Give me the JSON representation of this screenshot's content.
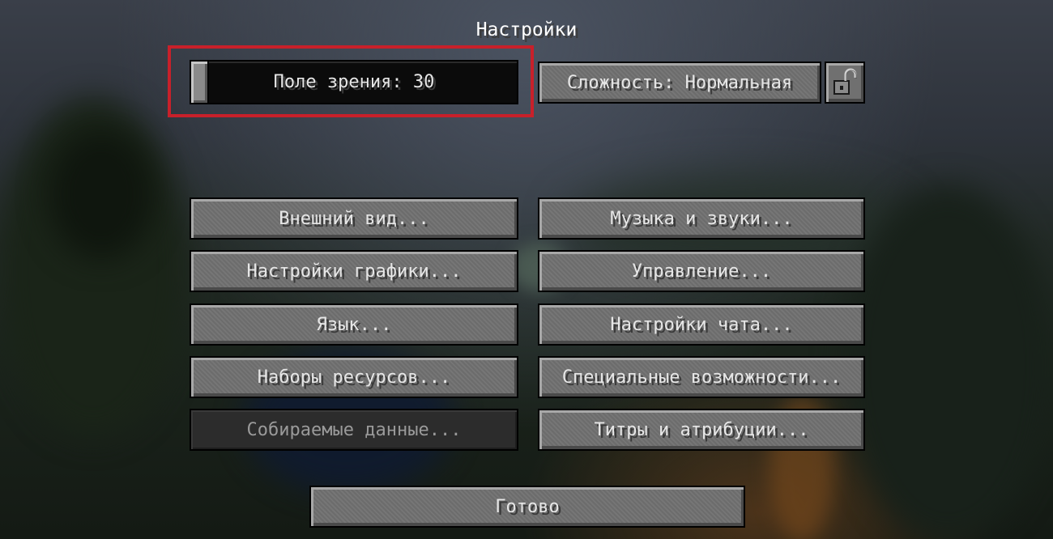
{
  "screen": {
    "title": "Настройки"
  },
  "fov_slider": {
    "label": "Поле зрения: 30",
    "value_fraction": 0.0
  },
  "difficulty": {
    "label": "Сложность: Нормальная",
    "lock_icon": "unlocked-padlock-icon"
  },
  "menu": {
    "appearance": "Внешний вид...",
    "music": "Музыка и звуки...",
    "graphics": "Настройки графики...",
    "controls": "Управление...",
    "language": "Язык...",
    "chat": "Настройки чата...",
    "resource_packs": "Наборы ресурсов...",
    "accessibility": "Специальные возможности...",
    "telemetry": "Собираемые данные...",
    "credits": "Титры и атрибуции..."
  },
  "done_label": "Готово",
  "colors": {
    "highlight": "#c8202a",
    "button": "#707070",
    "disabled": "#2c2c2c"
  }
}
